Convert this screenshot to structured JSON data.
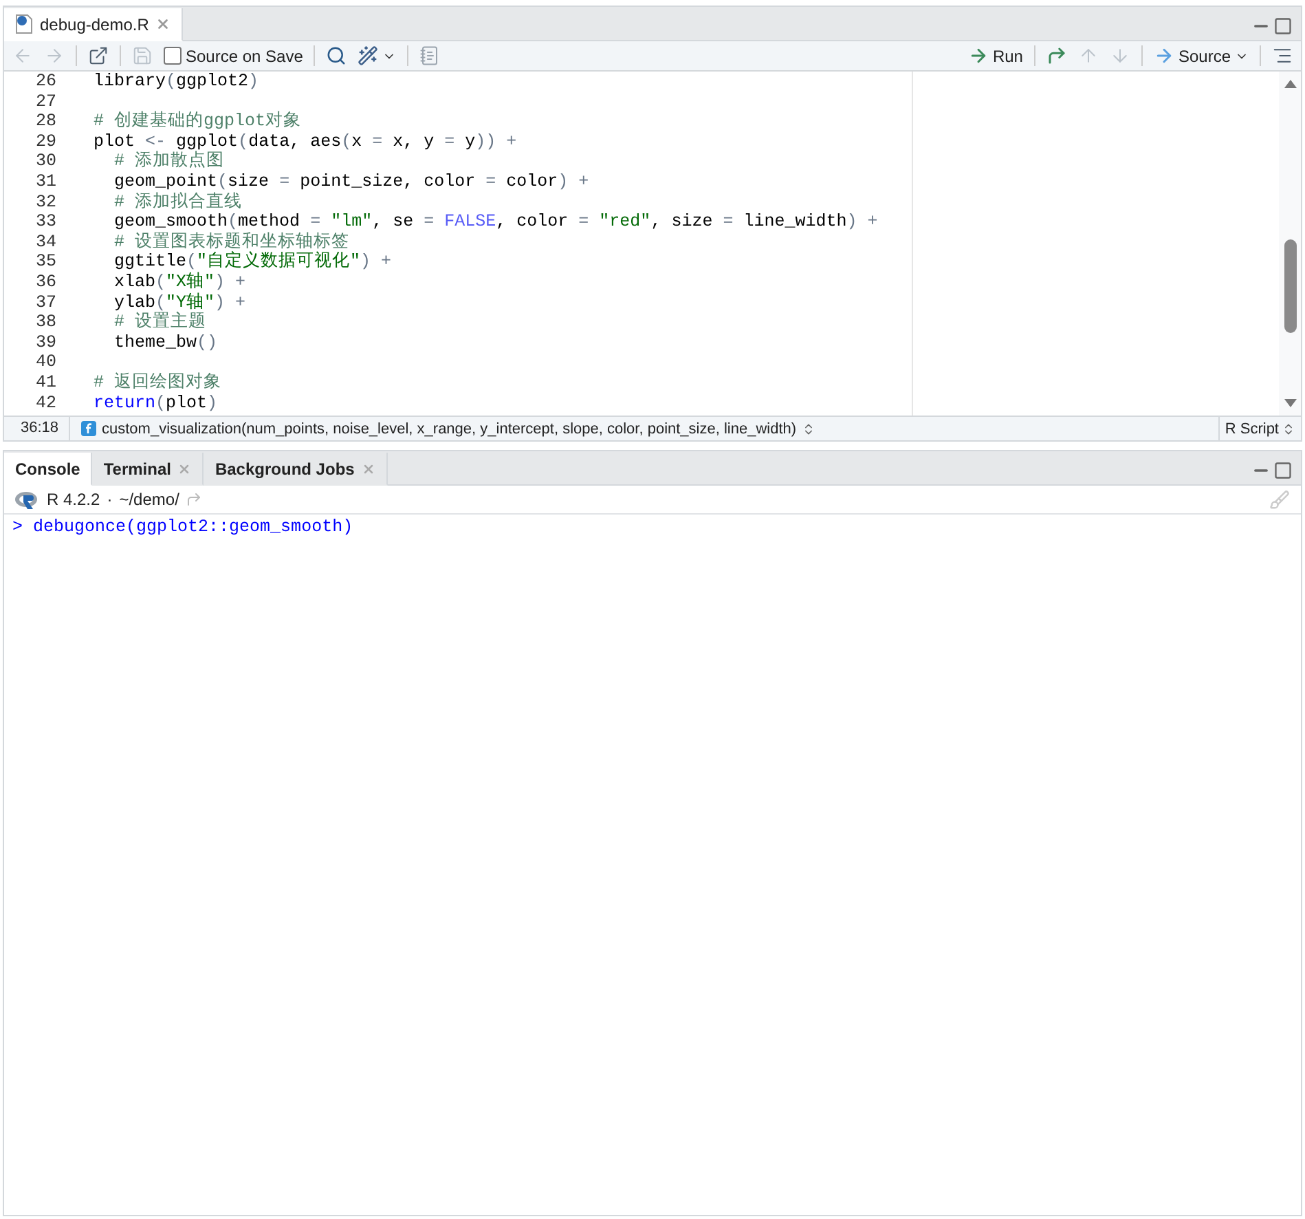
{
  "editor": {
    "tabs": [
      {
        "label": "debug-demo.R",
        "selected": true,
        "closable": true
      }
    ],
    "toolbar": {
      "left": [
        {
          "kind": "back",
          "disabled": true
        },
        {
          "kind": "forward",
          "disabled": true
        },
        {
          "kind": "popout",
          "disabled": false
        },
        {
          "kind": "save",
          "disabled": true
        },
        {
          "kind": "checkbox",
          "label": "Source on Save",
          "checked": false
        },
        {
          "kind": "search",
          "disabled": false
        },
        {
          "kind": "wand",
          "disabled": false
        },
        {
          "kind": "notebook",
          "disabled": false
        }
      ],
      "right": [
        {
          "kind": "run",
          "label": "Run",
          "disabled": false
        },
        {
          "kind": "rerun",
          "disabled": false
        },
        {
          "kind": "up",
          "disabled": true
        },
        {
          "kind": "down",
          "disabled": true
        },
        {
          "kind": "source",
          "label": "Source",
          "disabled": false
        },
        {
          "kind": "outline",
          "disabled": false
        }
      ]
    },
    "lines": [
      {
        "number": "26",
        "tokens": [
          {
            "kind": "text",
            "text": "  library"
          },
          {
            "kind": "op",
            "text": "("
          },
          {
            "kind": "text",
            "text": "ggplot2"
          },
          {
            "kind": "op",
            "text": ")"
          }
        ]
      },
      {
        "number": "27"
      },
      {
        "number": "28",
        "tokens": [
          {
            "kind": "comment",
            "text": "  # 创建基础的ggplot对象"
          }
        ]
      },
      {
        "number": "29",
        "tokens": [
          {
            "kind": "text",
            "text": "  plot "
          },
          {
            "kind": "op",
            "text": "<-"
          },
          {
            "kind": "text",
            "text": " ggplot"
          },
          {
            "kind": "op",
            "text": "("
          },
          {
            "kind": "text",
            "text": "data, aes"
          },
          {
            "kind": "op",
            "text": "("
          },
          {
            "kind": "text",
            "text": "x "
          },
          {
            "kind": "op",
            "text": "="
          },
          {
            "kind": "text",
            "text": " x, y "
          },
          {
            "kind": "op",
            "text": "="
          },
          {
            "kind": "text",
            "text": " y"
          },
          {
            "kind": "op",
            "text": ")) +"
          }
        ]
      },
      {
        "number": "30",
        "tokens": [
          {
            "kind": "comment",
            "text": "    # 添加散点图"
          }
        ]
      },
      {
        "number": "31",
        "tokens": [
          {
            "kind": "text",
            "text": "    geom_point"
          },
          {
            "kind": "op",
            "text": "("
          },
          {
            "kind": "text",
            "text": "size "
          },
          {
            "kind": "op",
            "text": "="
          },
          {
            "kind": "text",
            "text": " point_size, color "
          },
          {
            "kind": "op",
            "text": "="
          },
          {
            "kind": "text",
            "text": " color"
          },
          {
            "kind": "op",
            "text": ") +"
          }
        ]
      },
      {
        "number": "32",
        "tokens": [
          {
            "kind": "comment",
            "text": "    # 添加拟合直线"
          }
        ]
      },
      {
        "number": "33",
        "tokens": [
          {
            "kind": "text",
            "text": "    geom_smooth"
          },
          {
            "kind": "op",
            "text": "("
          },
          {
            "kind": "text",
            "text": "method "
          },
          {
            "kind": "op",
            "text": "="
          },
          {
            "kind": "string",
            "text": " \"lm\""
          },
          {
            "kind": "text",
            "text": ", se "
          },
          {
            "kind": "op",
            "text": "="
          },
          {
            "kind": "constant",
            "text": " FALSE"
          },
          {
            "kind": "text",
            "text": ", color "
          },
          {
            "kind": "op",
            "text": "="
          },
          {
            "kind": "string",
            "text": " \"red\""
          },
          {
            "kind": "text",
            "text": ", size "
          },
          {
            "kind": "op",
            "text": "="
          },
          {
            "kind": "text",
            "text": " line_width"
          },
          {
            "kind": "op",
            "text": ") +"
          }
        ]
      },
      {
        "number": "34",
        "tokens": [
          {
            "kind": "comment",
            "text": "    # 设置图表标题和坐标轴标签"
          }
        ]
      },
      {
        "number": "35",
        "tokens": [
          {
            "kind": "text",
            "text": "    ggtitle"
          },
          {
            "kind": "op",
            "text": "("
          },
          {
            "kind": "string",
            "text": "\"自定义数据可视化\""
          },
          {
            "kind": "op",
            "text": ") +"
          }
        ]
      },
      {
        "number": "36",
        "tokens": [
          {
            "kind": "text",
            "text": "    xlab"
          },
          {
            "kind": "op",
            "text": "("
          },
          {
            "kind": "string",
            "text": "\"X轴\""
          },
          {
            "kind": "op",
            "text": ") +"
          }
        ]
      },
      {
        "number": "37",
        "tokens": [
          {
            "kind": "text",
            "text": "    ylab"
          },
          {
            "kind": "op",
            "text": "("
          },
          {
            "kind": "string",
            "text": "\"Y轴\""
          },
          {
            "kind": "op",
            "text": ") +"
          }
        ]
      },
      {
        "number": "38",
        "tokens": [
          {
            "kind": "comment",
            "text": "    # 设置主题"
          }
        ]
      },
      {
        "number": "39",
        "tokens": [
          {
            "kind": "text",
            "text": "    theme_bw"
          },
          {
            "kind": "op",
            "text": "()"
          }
        ]
      },
      {
        "number": "40"
      },
      {
        "number": "41",
        "tokens": [
          {
            "kind": "comment",
            "text": "  # 返回绘图对象"
          }
        ]
      },
      {
        "number": "42",
        "tokens": [
          {
            "kind": "keyword",
            "text": "  return"
          },
          {
            "kind": "op",
            "text": "("
          },
          {
            "kind": "text",
            "text": "plot"
          },
          {
            "kind": "op",
            "text": ")"
          }
        ]
      }
    ],
    "status_bar": {
      "position": "36:18",
      "scope": "custom_visualization(num_points, noise_level, x_range, y_intercept, slope, color, point_size, line_width)",
      "file_type": "R Script"
    }
  },
  "console": {
    "tabs": [
      {
        "label": "Console",
        "selected": true,
        "closable": false
      },
      {
        "label": "Terminal",
        "selected": false,
        "closable": true
      },
      {
        "label": "Background Jobs",
        "selected": false,
        "closable": true
      }
    ],
    "version": "R 4.2.2",
    "separator": "·",
    "path": "~/demo/",
    "prompt": ">",
    "input": "debugonce(ggplot2::geom_smooth)"
  }
}
